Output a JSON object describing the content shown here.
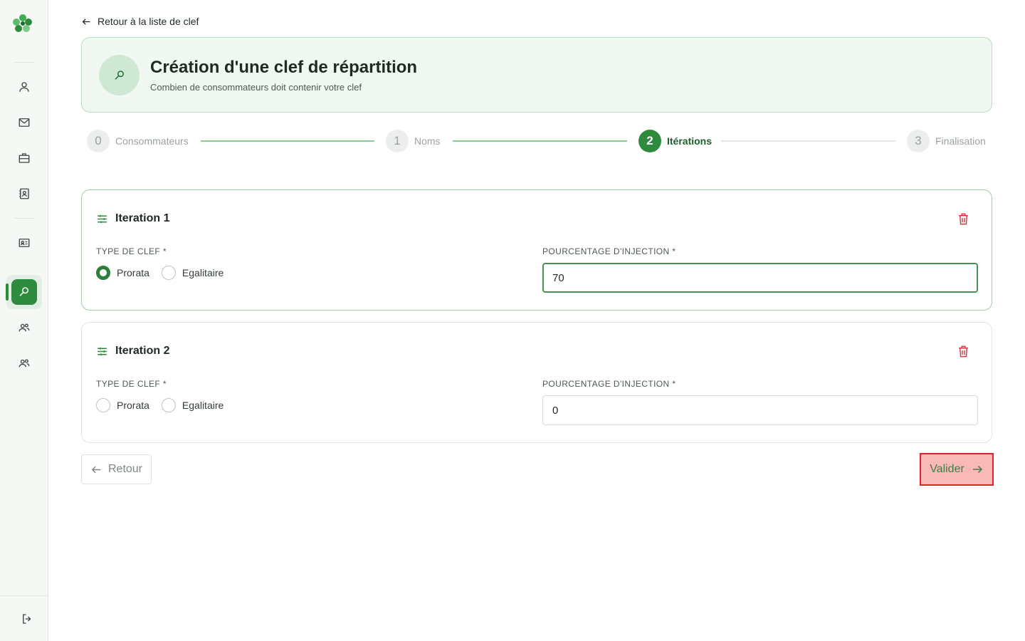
{
  "nav": {
    "back_to_list": "Retour à la liste de clef"
  },
  "hero": {
    "title": "Création d'une clef de répartition",
    "subtitle": "Combien de consommateurs doit contenir votre clef"
  },
  "stepper": {
    "steps": [
      {
        "number": "0",
        "label": "Consommateurs",
        "state": "completed"
      },
      {
        "number": "1",
        "label": "Noms",
        "state": "completed"
      },
      {
        "number": "2",
        "label": "Itérations",
        "state": "active"
      },
      {
        "number": "3",
        "label": "Finalisation",
        "state": "pending"
      }
    ]
  },
  "iterations": [
    {
      "title": "Iteration 1",
      "type_label": "TYPE DE CLEF *",
      "options": [
        "Prorata",
        "Egalitaire"
      ],
      "selected": "Prorata",
      "percent_label": "POURCENTAGE D'INJECTION *",
      "percent_value": "70"
    },
    {
      "title": "Iteration 2",
      "type_label": "TYPE DE CLEF *",
      "options": [
        "Prorata",
        "Egalitaire"
      ],
      "selected": null,
      "percent_label": "POURCENTAGE D'INJECTION *",
      "percent_value": "0"
    }
  ],
  "actions": {
    "back_label": "Retour",
    "submit_label": "Valider"
  },
  "sidebar": {
    "icons": [
      "logo-icon",
      "user-icon",
      "mail-icon",
      "briefcase-icon",
      "contact-book-icon",
      "id-card-icon",
      "key-icon",
      "users-icon",
      "users-alt-icon",
      "logout-icon"
    ],
    "active": "key-icon"
  },
  "colors": {
    "primary": "#2e8b3e",
    "hero_bg": "#f1f8f2",
    "danger": "#d9363e",
    "highlight_bg": "#f9b9b9"
  }
}
